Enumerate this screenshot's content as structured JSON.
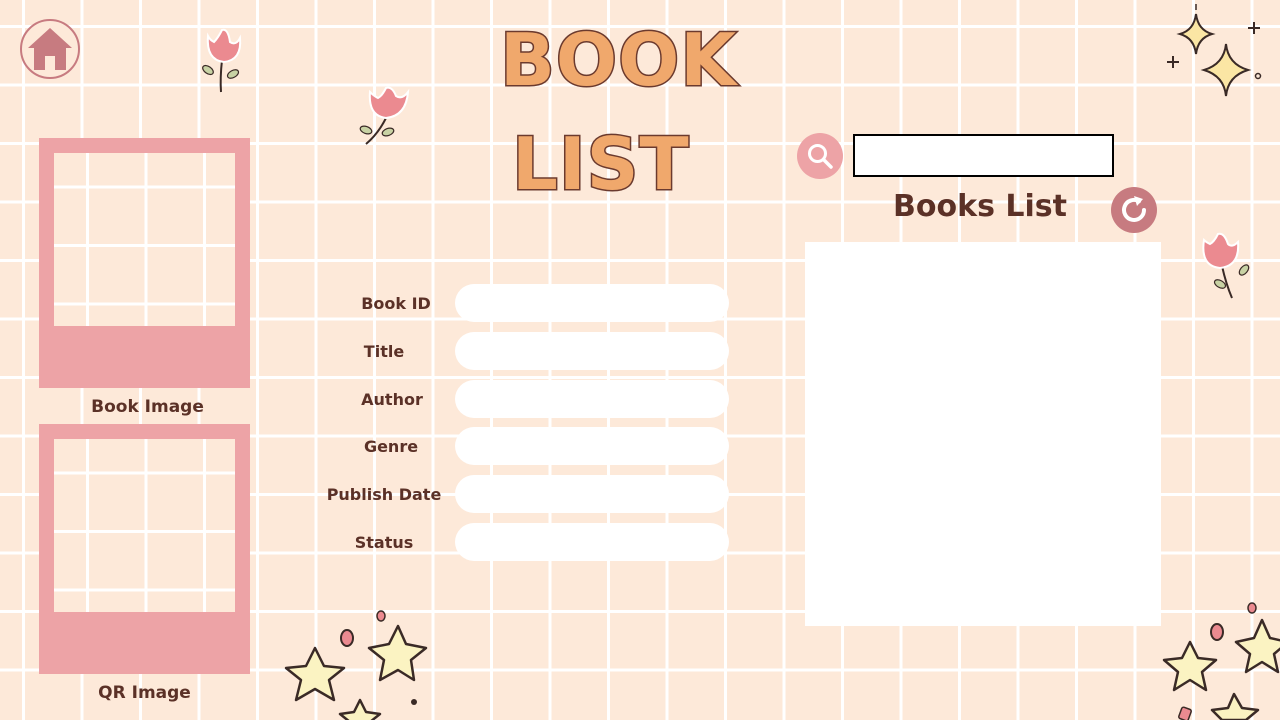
{
  "header": {
    "title_line1": "BOOK",
    "title_line2": "LIST"
  },
  "images": {
    "book_image_label": "Book Image",
    "qr_image_label": "QR Image"
  },
  "form": {
    "fields": [
      {
        "label": "Book ID",
        "value": ""
      },
      {
        "label": "Title",
        "value": ""
      },
      {
        "label": "Author",
        "value": ""
      },
      {
        "label": "Genre",
        "value": ""
      },
      {
        "label": "Publish Date",
        "value": ""
      },
      {
        "label": "Status",
        "value": ""
      }
    ]
  },
  "search": {
    "value": "",
    "button_icon": "search-icon"
  },
  "books_list": {
    "title": "Books List",
    "refresh_icon": "refresh-icon",
    "items": []
  },
  "icons": {
    "home": "home-icon"
  },
  "colors": {
    "background": "#fde9d9",
    "accent_pink": "#eda3a6",
    "dark_pink": "#c77b80",
    "text_brown": "#5b3127",
    "title_orange": "#f0a86c"
  }
}
